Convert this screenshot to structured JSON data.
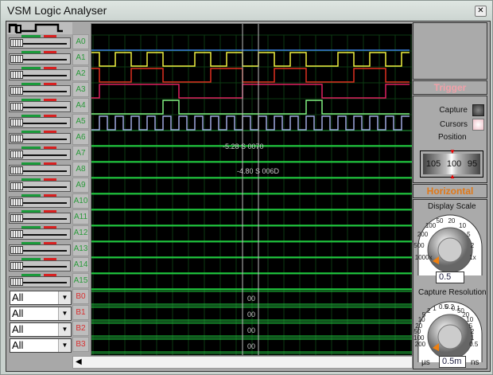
{
  "window": {
    "title": "VSM Logic Analyser",
    "close_icon": "close-icon"
  },
  "channels": [
    "A0",
    "A1",
    "A2",
    "A3",
    "A4",
    "A5",
    "A6",
    "A7",
    "A8",
    "A9",
    "A10",
    "A11",
    "A12",
    "A13",
    "A14",
    "A15"
  ],
  "buses": [
    "B0",
    "B1",
    "B2",
    "B3"
  ],
  "bus_selects": [
    "All",
    "All",
    "All",
    "All"
  ],
  "bus_values": [
    "00",
    "00",
    "00",
    "00"
  ],
  "colors": {
    "A0": "#3b7fe0",
    "A1": "#f0f040",
    "A2": "#e03020",
    "A3": "#e02060",
    "A4": "#80f080",
    "A5": "#a0a8e0",
    "idle": "#20d040",
    "channel_label": "#2a9a3a",
    "bus_label": "#d83030",
    "trigger": "#f0a0a8",
    "horizontal": "#e07818"
  },
  "waveforms": {
    "A0": "0000000000000000000000000000000000000000",
    "A1": "1001100110000110011001100110000110011001",
    "A2": "1000011110000001111000011110000001111000",
    "A3": "0111111111100000000111111111100000000111",
    "A4": "0000000001100000000000000001100000000000",
    "A5": "0101010101010101010101010101010101010101"
  },
  "cursors": [
    {
      "label": "-5.28 S 0070"
    },
    {
      "label": "-4.80 S 006D"
    }
  ],
  "trigger": {
    "title": "Trigger",
    "capture": "Capture",
    "cursors": "Cursors",
    "position": "Position",
    "dial": [
      "105",
      "100",
      "95"
    ]
  },
  "horizontal": {
    "title": "Horizontal",
    "display_scale": {
      "label": "Display Scale",
      "ticks": [
        "1000x",
        "500",
        "200",
        "100",
        "50",
        "20",
        "10",
        "5",
        "2",
        "1x"
      ],
      "value": "0.5"
    },
    "capture_resolution": {
      "label": "Capture Resolution",
      "ticks_left": [
        "200",
        "100",
        "50",
        "20",
        "10",
        "5",
        "2",
        "1",
        "0.5",
        "0.2",
        "0.1"
      ],
      "ticks_right": [
        "50",
        "20",
        "10",
        "5",
        "2",
        "1",
        "0.5"
      ],
      "unit_left": "µs",
      "unit_right": "ns",
      "value": "0.5m"
    }
  }
}
